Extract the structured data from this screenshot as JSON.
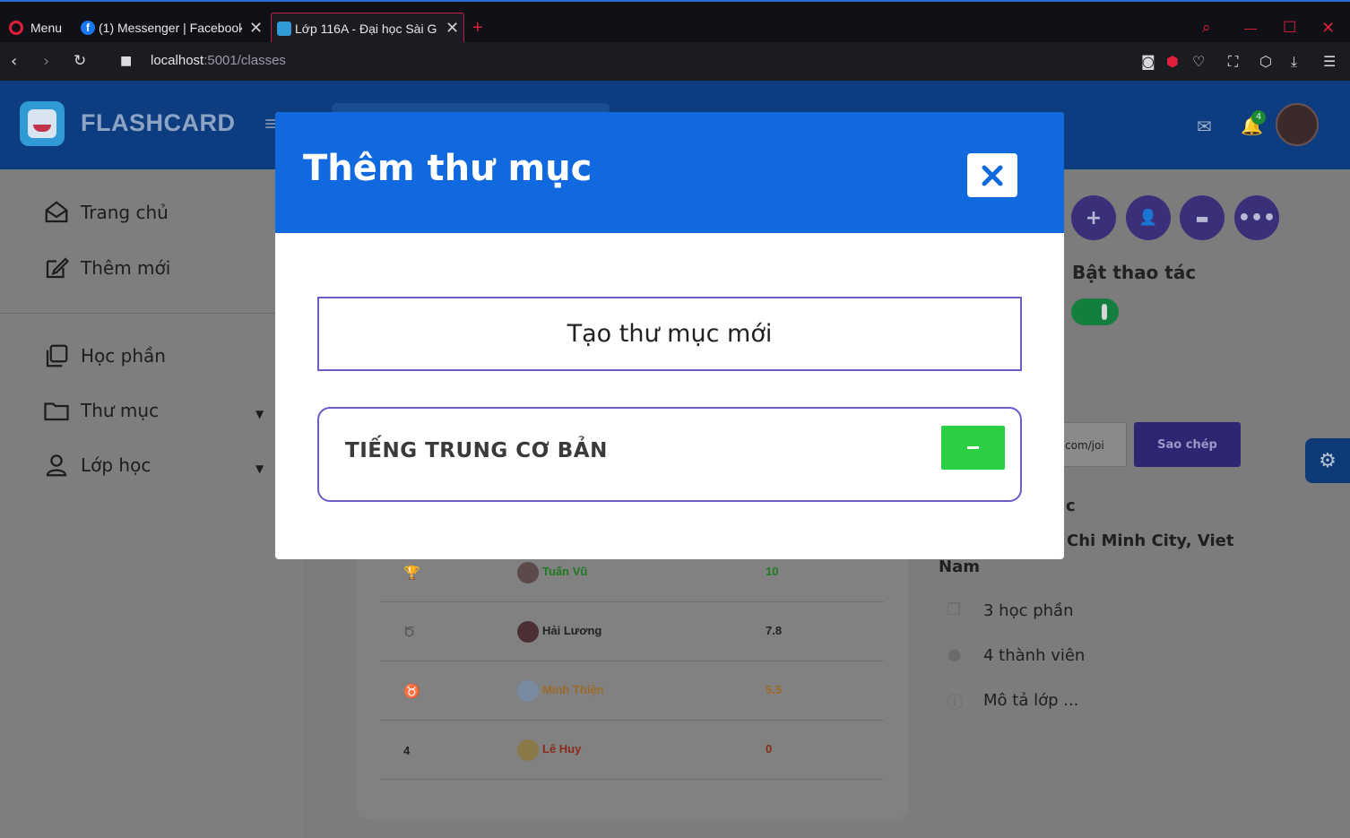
{
  "browser": {
    "menu_label": "Menu",
    "tabs": [
      {
        "title": "(1) Messenger | Facebook"
      },
      {
        "title": "Lớp 116A - Đại học Sài G"
      }
    ],
    "url_host": "localhost",
    "url_rest": ":5001/classes"
  },
  "app": {
    "brand": "FLASHCARD",
    "notification_count": "4",
    "sidebar": {
      "home": "Trang chủ",
      "add_new": "Thêm mới",
      "study_sets": "Học phần",
      "folders": "Thư mục",
      "classes": "Lớp học"
    },
    "toggle_label": "Bật thao tác",
    "link_snippet": "com/joi",
    "copy_button": "Sao chép",
    "class_info": {
      "title_partial": "c",
      "location_line1": "Chi Minh City, Viet",
      "location_line2": "Nam",
      "study_sets": "3 học phần",
      "members": "4 thành viên",
      "description": "Mô tả lớp ..."
    },
    "ranking": [
      {
        "rank": "",
        "name": "Tuấn Vũ",
        "score": "10",
        "color": "#1e7a1e"
      },
      {
        "rank": "",
        "name": "Hải Lương",
        "score": "7.8",
        "color": "#222222"
      },
      {
        "rank": "",
        "name": "Minh Thiện",
        "score": "5.5",
        "color": "#9a6a28"
      },
      {
        "rank": "4",
        "name": "Lê Huy",
        "score": "0",
        "color": "#8a2a1a"
      }
    ]
  },
  "modal": {
    "title": "Thêm thư mục",
    "new_folder_button": "Tạo thư mục mới",
    "folders": [
      {
        "name": "TIẾNG TRUNG CƠ BẢN"
      }
    ]
  },
  "colors": {
    "modal_header": "#1169e0",
    "accent_purple": "#6b5cc7",
    "remove_green": "#2bd042"
  }
}
